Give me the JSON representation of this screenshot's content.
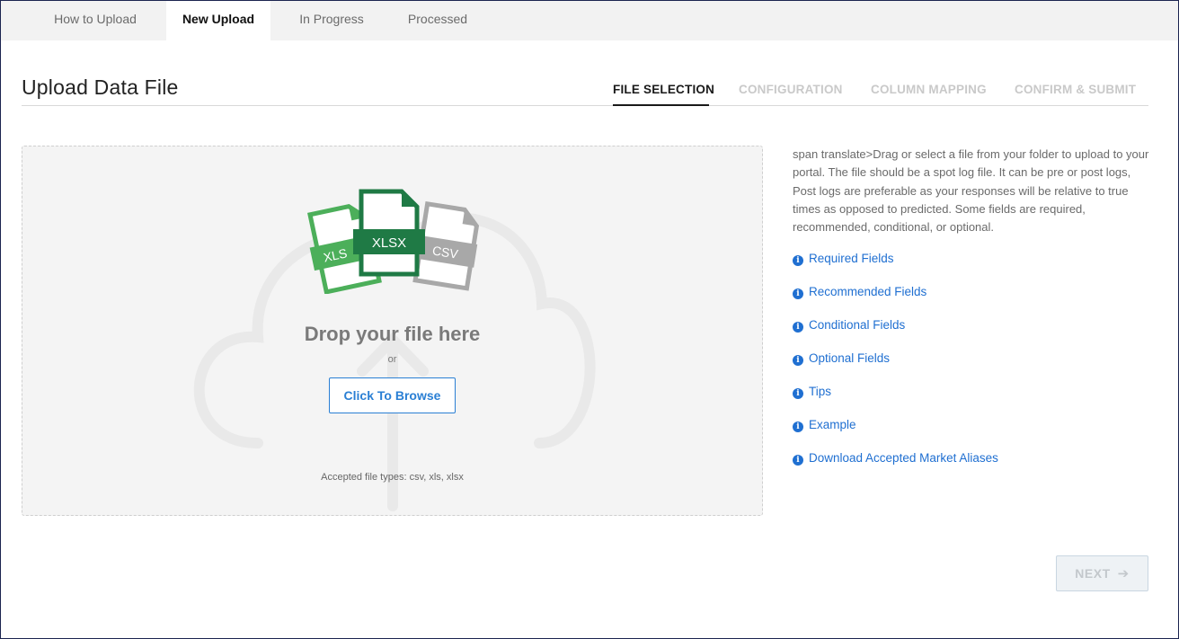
{
  "top_tabs": [
    {
      "label": "How to Upload",
      "active": false
    },
    {
      "label": "New Upload",
      "active": true
    },
    {
      "label": "In Progress",
      "active": false
    },
    {
      "label": "Processed",
      "active": false
    }
  ],
  "header": {
    "title": "Upload Data File",
    "steps": [
      "FILE SELECTION",
      "CONFIGURATION",
      "COLUMN MAPPING",
      "CONFIRM & SUBMIT"
    ],
    "active_step": "FILE SELECTION"
  },
  "dropzone": {
    "file_labels": [
      "XLS",
      "XLSX",
      "CSV"
    ],
    "title": "Drop your file here",
    "or": "or",
    "browse_label": "Click To Browse",
    "accepted": "Accepted file types: csv, xls, xlsx"
  },
  "description": "span translate>Drag or select a file from your folder to upload to your portal. The file should be a spot log file. It can be pre or post logs, Post logs are preferable as your responses will be relative to true times as opposed to predicted. Some fields are required, recommended, conditional, or optional.",
  "info_links": [
    "Required Fields",
    "Recommended Fields",
    "Conditional Fields",
    "Optional Fields",
    "Tips",
    "Example",
    "Download Accepted Market Aliases"
  ],
  "next_label": "NEXT",
  "colors": {
    "accent": "#2a7fd4",
    "link": "#1f6fd1",
    "xlsx_green": "#1f7a45",
    "xls_green": "#4caf5a",
    "csv_gray": "#a8a8a8"
  },
  "icons": {
    "info": "info-circle-icon",
    "next_arrow": "arrow-right-icon",
    "background": "cloud-upload-icon"
  }
}
